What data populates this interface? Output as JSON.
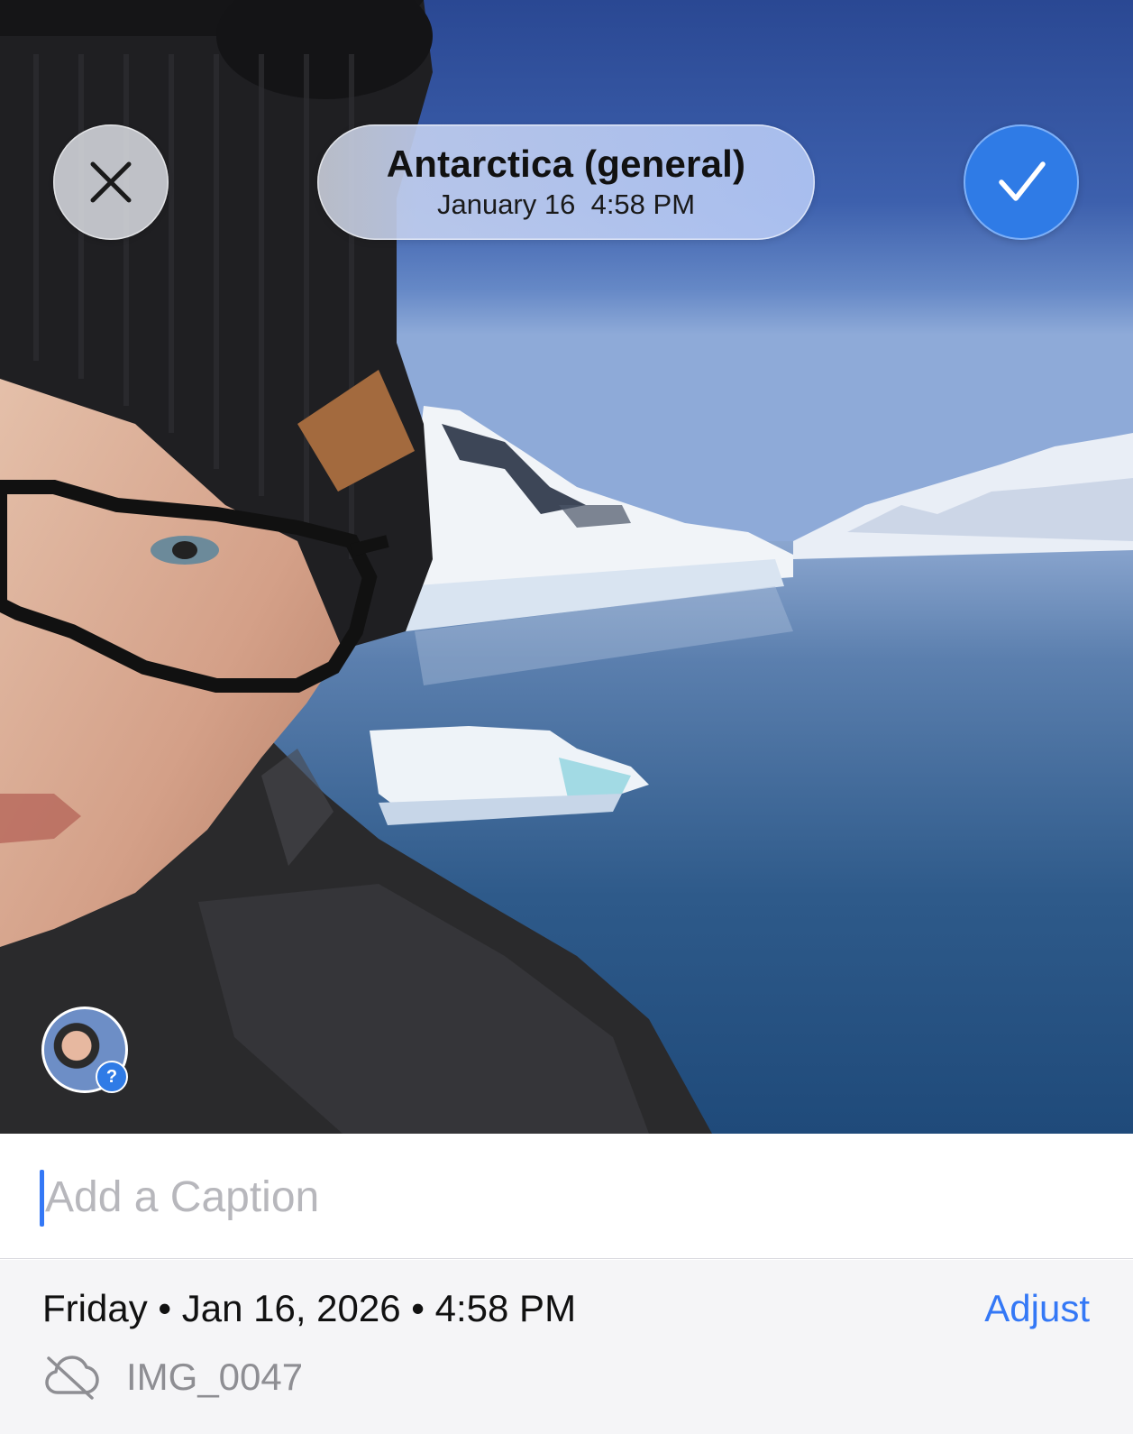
{
  "header": {
    "place": "Antarctica (general)",
    "date": "January 16",
    "time": "4:58 PM",
    "when_text": "January 16  4:58 PM",
    "close_icon": "close-icon",
    "done_icon": "checkmark-icon"
  },
  "photo": {
    "face_badge": "?"
  },
  "caption": {
    "placeholder": "Add a Caption",
    "value": ""
  },
  "info": {
    "datetime_text": "Friday • Jan 16, 2026 • 4:58 PM",
    "adjust_label": "Adjust",
    "filename": "IMG_0047",
    "cloud_icon": "cloud-off-icon"
  },
  "colors": {
    "accent": "#3478f6",
    "done_button": "#2f7be6",
    "placeholder": "#b7b7bc",
    "secondary_text": "#8e8e93",
    "info_background": "#f5f5f7"
  }
}
